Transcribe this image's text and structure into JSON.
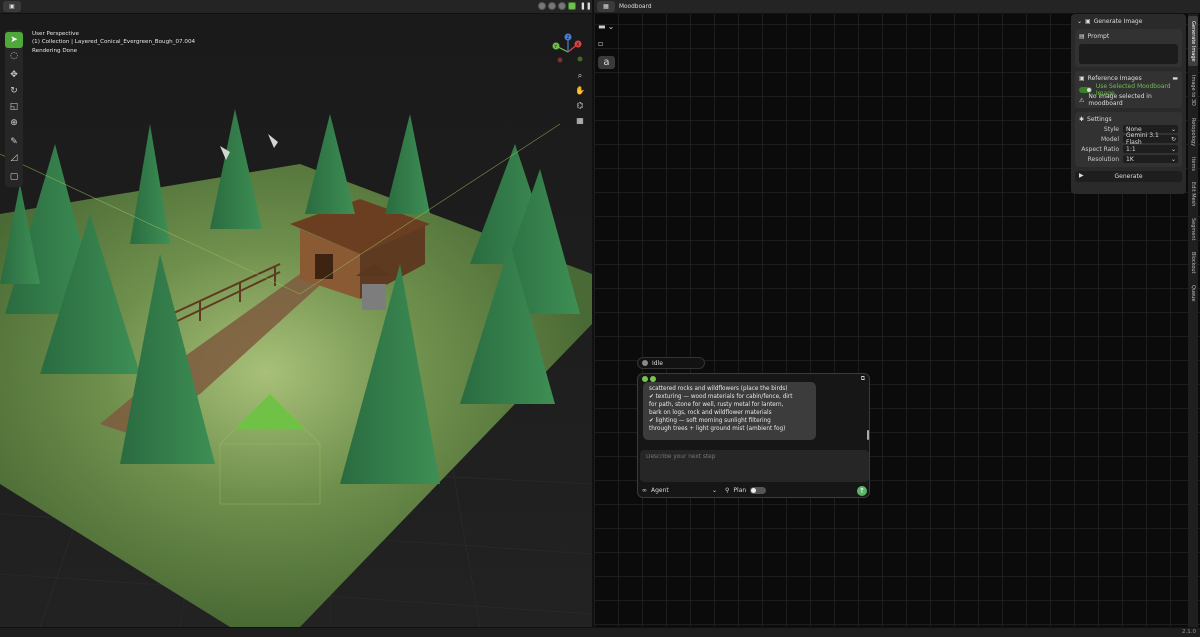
{
  "viewport": {
    "editor_type_icon": "cube-icon",
    "info": {
      "perspective": "User Perspective",
      "collection": "(1) Collection | Layered_Conical_Evergreen_Bough_07.004",
      "status": "Rendering Done"
    },
    "tools": [
      "tweak-icon",
      "select-circle-icon",
      "move-icon",
      "rotate-icon",
      "scale-icon",
      "transform-icon",
      "annotate-icon",
      "measure-icon",
      "add-cube-icon"
    ],
    "gizmo_labels": {
      "x": "X",
      "y": "Y",
      "z": "Z"
    }
  },
  "moodboard": {
    "header_title": "Moodboard",
    "text_tool_glyph": "a"
  },
  "generate_panel": {
    "title": "Generate Image",
    "prompt_label": "Prompt",
    "reference_label": "Reference Images",
    "use_selected_label": "Use Selected Moodboard Image",
    "warning_text": "No image selected in moodboard",
    "settings_label": "Settings",
    "settings": [
      {
        "label": "Style",
        "value": "None"
      },
      {
        "label": "Model",
        "value": "Gemini 3.1 Flash"
      },
      {
        "label": "Aspect Ratio",
        "value": "1:1"
      },
      {
        "label": "Resolution",
        "value": "1K"
      }
    ],
    "generate_label": "Generate"
  },
  "side_tabs": [
    "Generate Image",
    "Image to 3D",
    "Retopology",
    "Items",
    "Edit Mesh",
    "Segment",
    "Blockout",
    "Queue"
  ],
  "chat": {
    "status": "Idle",
    "message_lines": [
      "scattered rocks and wildflowers (place the birds)",
      "✔ texturing — wood materials for cabin/fence, dirt",
      "for path, stone for well, rusty metal for lantern,",
      "bark on logs, rock and wildflower materials",
      "✔ lighting — soft morning sunlight filtering",
      "through trees + light ground mist (ambient fog)"
    ],
    "input_placeholder": "Describe your next step",
    "agent_label": "Agent",
    "plan_label": "Plan"
  },
  "statusbar": {
    "version": "2.1.0"
  },
  "colors": {
    "accent": "#4fa93a",
    "toggle_on": "#3b7f2a",
    "send": "#5ab56a"
  }
}
